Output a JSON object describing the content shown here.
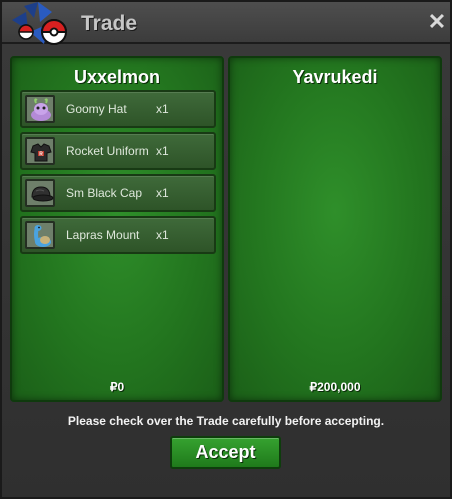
{
  "window": {
    "title": "Trade",
    "close_icon": "close-icon"
  },
  "left_panel": {
    "player_name": "Uxxelmon",
    "money": "₽0",
    "items": [
      {
        "name": "Goomy Hat",
        "qty": "x1",
        "icon": "goomy-hat-icon"
      },
      {
        "name": "Rocket Uniform",
        "qty": "x1",
        "icon": "rocket-uniform-icon"
      },
      {
        "name": "Sm Black Cap",
        "qty": "x1",
        "icon": "black-cap-icon"
      },
      {
        "name": "Lapras Mount",
        "qty": "x1",
        "icon": "lapras-icon"
      }
    ]
  },
  "right_panel": {
    "player_name": "Yavrukedi",
    "money": "₽200,000",
    "items": []
  },
  "footer": {
    "notice": "Please check over the Trade carefully before accepting.",
    "accept_label": "Accept"
  },
  "colors": {
    "panel_green": "#23761f",
    "accept_green": "#2a8e25",
    "window_gray": "#3a3a3a"
  }
}
